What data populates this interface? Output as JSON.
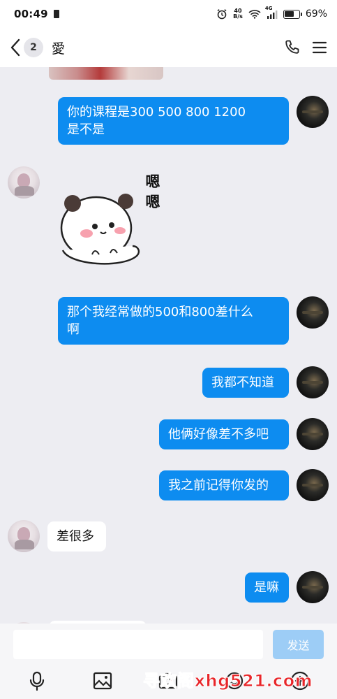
{
  "status_bar": {
    "time": "00:49",
    "net_speed_value": "40",
    "net_speed_unit": "B/s",
    "network_type": "4G",
    "battery_percent": "69%",
    "battery_level": 0.69
  },
  "header": {
    "unread_count": "2",
    "contact_name": "愛"
  },
  "messages": [
    {
      "sender": "me",
      "text": "你的课程是300   500  800  1200\n是不是"
    },
    {
      "sender": "other",
      "type": "sticker",
      "sticker_text": "嗯\n嗯"
    },
    {
      "sender": "me",
      "text": "那个我经常做的500和800差什么\n啊"
    },
    {
      "sender": "me",
      "text": "我都不知道"
    },
    {
      "sender": "me",
      "text": "他俩好像差不多吧"
    },
    {
      "sender": "me",
      "text": "我之前记得你发的"
    },
    {
      "sender": "other",
      "text": "差很多"
    },
    {
      "sender": "me",
      "text": "是嘛"
    }
  ],
  "input": {
    "value": "",
    "send_label": "发送"
  },
  "watermark": "寻欢阁xhg521.com",
  "colors": {
    "my_bubble": "#0d8cf0",
    "other_bubble": "#ffffff",
    "chat_background": "#ededf2",
    "send_button_disabled": "#9dcdf6"
  },
  "icons": {
    "status": [
      "alarm-icon",
      "wifi-icon",
      "signal-icon",
      "battery-icon",
      "sim-icon"
    ],
    "header": [
      "back-chevron-icon",
      "phone-icon",
      "menu-icon"
    ],
    "toolbar": [
      "microphone-icon",
      "image-icon",
      "camera-icon",
      "emoji-icon",
      "add-icon"
    ]
  }
}
